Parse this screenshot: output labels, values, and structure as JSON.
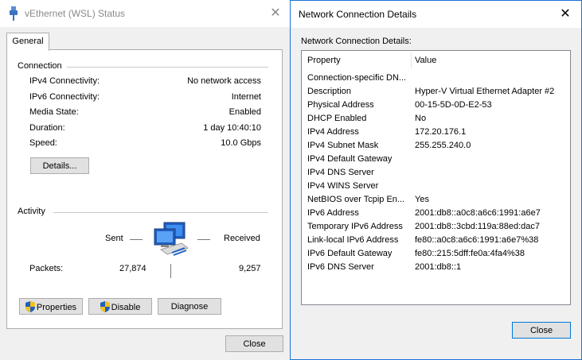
{
  "status_window": {
    "title": "vEthernet (WSL) Status",
    "close_glyph": "✕",
    "tab": "General",
    "connection": {
      "label": "Connection",
      "rows": [
        {
          "label": "IPv4 Connectivity:",
          "value": "No network access"
        },
        {
          "label": "IPv6 Connectivity:",
          "value": "Internet"
        },
        {
          "label": "Media State:",
          "value": "Enabled"
        },
        {
          "label": "Duration:",
          "value": "1 day 10:40:10"
        },
        {
          "label": "Speed:",
          "value": "10.0 Gbps"
        }
      ],
      "details_button": "Details..."
    },
    "activity": {
      "label": "Activity",
      "sent_label": "Sent",
      "received_label": "Received",
      "packets_label": "Packets:",
      "packets_sent": "27,874",
      "packets_received": "9,257"
    },
    "buttons": {
      "properties": "Properties",
      "disable": "Disable",
      "diagnose": "Diagnose",
      "close": "Close"
    }
  },
  "details_window": {
    "title": "Network Connection Details",
    "close_glyph": "✕",
    "subtitle": "Network Connection Details:",
    "columns": {
      "property": "Property",
      "value": "Value"
    },
    "rows": [
      {
        "property": "Connection-specific DN...",
        "value": ""
      },
      {
        "property": "Description",
        "value": "Hyper-V Virtual Ethernet Adapter #2"
      },
      {
        "property": "Physical Address",
        "value": "00-15-5D-0D-E2-53"
      },
      {
        "property": "DHCP Enabled",
        "value": "No"
      },
      {
        "property": "IPv4 Address",
        "value": "172.20.176.1"
      },
      {
        "property": "IPv4 Subnet Mask",
        "value": "255.255.240.0"
      },
      {
        "property": "IPv4 Default Gateway",
        "value": ""
      },
      {
        "property": "IPv4 DNS Server",
        "value": ""
      },
      {
        "property": "IPv4 WINS Server",
        "value": ""
      },
      {
        "property": "NetBIOS over Tcpip En...",
        "value": "Yes"
      },
      {
        "property": "IPv6 Address",
        "value": "2001:db8::a0c8:a6c6:1991:a6e7"
      },
      {
        "property": "Temporary IPv6 Address",
        "value": "2001:db8::3cbd:119a:88ed:dac7"
      },
      {
        "property": "Link-local IPv6 Address",
        "value": "fe80::a0c8:a6c6:1991:a6e7%38"
      },
      {
        "property": "IPv6 Default Gateway",
        "value": "fe80::215:5dff:fe0a:4fa4%38"
      },
      {
        "property": "IPv6 DNS Server",
        "value": "2001:db8::1"
      }
    ],
    "close_button": "Close"
  },
  "colors": {
    "accent": "#0078d7",
    "shield_blue": "#1f5fbf",
    "shield_yellow": "#f2c21b"
  },
  "icons": [
    "network-adapter-icon",
    "close-icon",
    "shield-icon",
    "network-computers-icon"
  ]
}
